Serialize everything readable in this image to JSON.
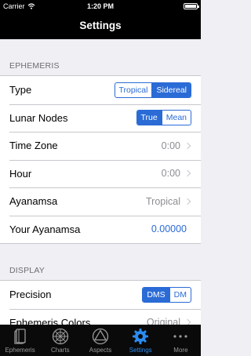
{
  "status": {
    "carrier": "Carrier",
    "time": "1:20 PM"
  },
  "nav": {
    "title": "Settings"
  },
  "ephemeris": {
    "header": "EPHEMERIS",
    "type": {
      "label": "Type",
      "options": [
        "Tropical",
        "Sidereal"
      ],
      "selected": "Sidereal"
    },
    "lunar_nodes": {
      "label": "Lunar Nodes",
      "options": [
        "True",
        "Mean"
      ],
      "selected": "True"
    },
    "time_zone": {
      "label": "Time Zone",
      "value": "0:00"
    },
    "hour": {
      "label": "Hour",
      "value": "0:00"
    },
    "ayanamsa": {
      "label": "Ayanamsa",
      "value": "Tropical"
    },
    "your_ayanamsa": {
      "label": "Your Ayanamsa",
      "value": "0.00000"
    }
  },
  "display": {
    "header": "DISPLAY",
    "precision": {
      "label": "Precision",
      "options": [
        "DMS",
        "DM"
      ],
      "selected": "DMS"
    },
    "ephemeris_colors": {
      "label": "Ephemeris Colors",
      "value": "Original"
    }
  },
  "tabs": [
    {
      "label": "Ephemeris",
      "icon": "book-icon",
      "active": false
    },
    {
      "label": "Charts",
      "icon": "wheel-icon",
      "active": false
    },
    {
      "label": "Aspects",
      "icon": "triangle-icon",
      "active": false
    },
    {
      "label": "Settings",
      "icon": "gear-icon",
      "active": true
    },
    {
      "label": "More",
      "icon": "more-icon",
      "active": false
    }
  ],
  "colors": {
    "accent": "#2a6bd6",
    "tab_active": "#2a8cf0",
    "bar": "#000000"
  }
}
